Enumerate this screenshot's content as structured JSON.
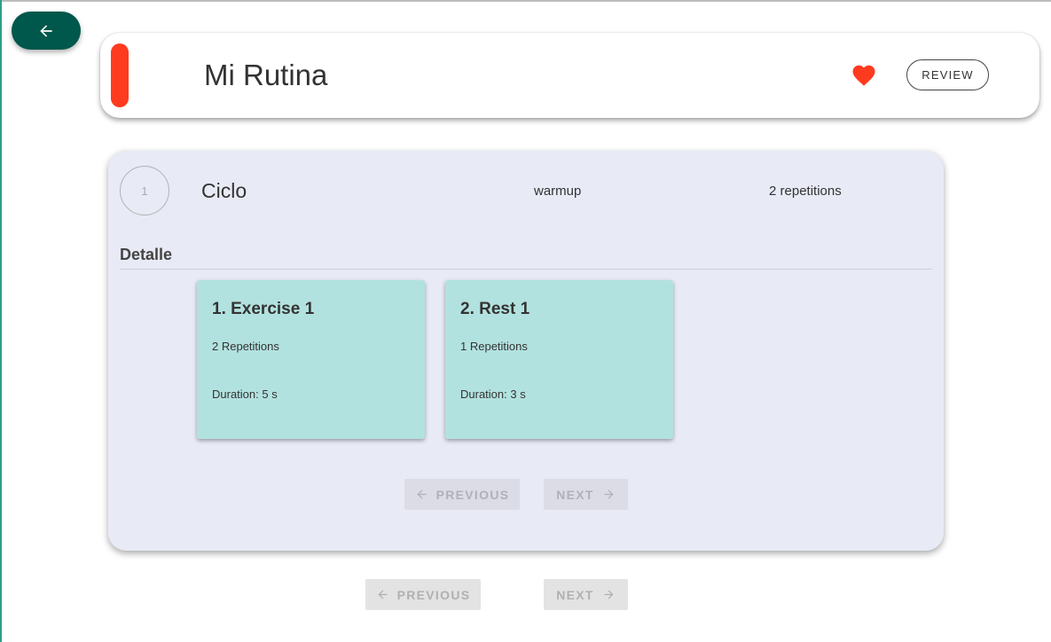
{
  "header": {
    "back_icon": "arrow-left-icon",
    "title": "Mi Rutina",
    "favorite_icon": "heart-icon",
    "review_label": "REVIEW",
    "colors": {
      "back": "#00574b",
      "accent_bar": "#ff3b1f",
      "heart": "#ff3b1f"
    }
  },
  "cycle": {
    "number": "1",
    "name": "Ciclo",
    "type": "warmup",
    "repetitions": "2 repetitions",
    "detail_heading": "Detalle",
    "exercises": [
      {
        "title": "1. Exercise 1",
        "repetitions": "2 Repetitions",
        "duration": "Duration: 5 s"
      },
      {
        "title": "2. Rest 1",
        "repetitions": "1 Repetitions",
        "duration": "Duration: 3 s"
      }
    ],
    "pagination": {
      "previous_label": "PREVIOUS",
      "next_label": "NEXT"
    }
  },
  "pagination": {
    "previous_label": "PREVIOUS",
    "next_label": "NEXT"
  }
}
